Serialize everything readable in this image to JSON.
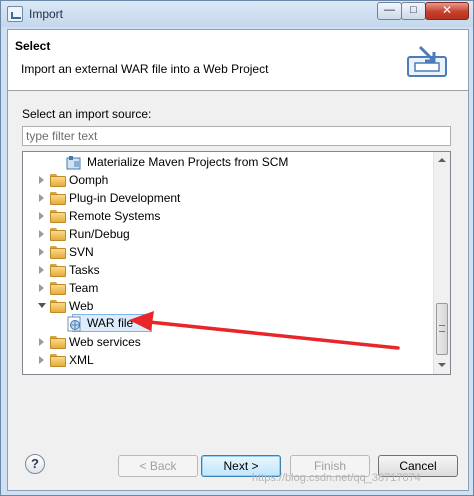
{
  "window": {
    "title": "Import",
    "minimize_glyph": "—",
    "maximize_glyph": "□",
    "close_glyph": "✕"
  },
  "banner": {
    "title": "Select",
    "description": "Import an external WAR file into a Web Project",
    "icon": "import-war-icon"
  },
  "source": {
    "label": "Select an import source:",
    "filter_placeholder": "type filter text"
  },
  "tree": {
    "items": [
      {
        "label": "Materialize Maven Projects from SCM",
        "icon": "maven-project-icon",
        "expanded": null
      },
      {
        "label": "Oomph",
        "icon": "folder-icon",
        "expanded": false
      },
      {
        "label": "Plug-in Development",
        "icon": "folder-icon",
        "expanded": false
      },
      {
        "label": "Remote Systems",
        "icon": "folder-icon",
        "expanded": false
      },
      {
        "label": "Run/Debug",
        "icon": "folder-icon",
        "expanded": false
      },
      {
        "label": "SVN",
        "icon": "folder-icon",
        "expanded": false
      },
      {
        "label": "Tasks",
        "icon": "folder-icon",
        "expanded": false
      },
      {
        "label": "Team",
        "icon": "folder-icon",
        "expanded": false
      },
      {
        "label": "Web",
        "icon": "folder-icon",
        "expanded": true
      },
      {
        "label": "WAR file",
        "icon": "war-file-icon",
        "selected": true
      },
      {
        "label": "Web services",
        "icon": "folder-icon",
        "expanded": false
      },
      {
        "label": "XML",
        "icon": "folder-icon",
        "expanded": false
      }
    ]
  },
  "buttons": {
    "help": "?",
    "back": "< Back",
    "next": "Next >",
    "finish": "Finish",
    "cancel": "Cancel"
  },
  "watermark": "https://blog.csdn.net/qq_38717074",
  "colors": {
    "selection_bg": "#dcecfc",
    "annotation_arrow": "#e8262a",
    "folder": "#e5ac3d"
  }
}
